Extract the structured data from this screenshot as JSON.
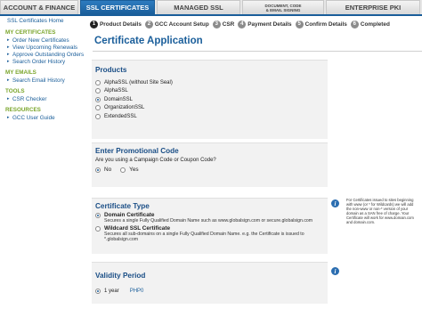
{
  "tabs": [
    {
      "label": "ACCOUNT & FINANCE",
      "active": false
    },
    {
      "label": "SSL CERTIFICATES",
      "active": true
    },
    {
      "label": "MANAGED SSL",
      "active": false
    },
    {
      "label1": "DOCUMENT, CODE",
      "label2": "& EMAIL SIGNING",
      "active": false
    },
    {
      "label": "ENTERPRISE PKI",
      "active": false
    }
  ],
  "sidebar": {
    "home": "SSL Certificates Home",
    "sections": [
      {
        "title": "MY CERTIFICATES",
        "items": [
          "Order New Certificates",
          "View Upcoming Renewals",
          "Approve Outstanding Orders",
          "Search Order History"
        ]
      },
      {
        "title": "MY EMAILS",
        "items": [
          "Search Email History"
        ]
      },
      {
        "title": "TOOLS",
        "items": [
          "CSR Checker"
        ]
      },
      {
        "title": "RESOURCES",
        "items": [
          "GCC User Guide"
        ]
      }
    ]
  },
  "steps": [
    {
      "num": "1",
      "label": "Product Details"
    },
    {
      "num": "2",
      "label": "GCC Account Setup"
    },
    {
      "num": "3",
      "label": "CSR"
    },
    {
      "num": "4",
      "label": "Payment Details"
    },
    {
      "num": "5",
      "label": "Confirm Details"
    },
    {
      "num": "6",
      "label": "Completed"
    }
  ],
  "page_title": "Certificate Application",
  "products": {
    "title": "Products",
    "options": [
      "AlphaSSL (without Site Seal)",
      "AlphaSSL",
      "DomainSSL",
      "OrganizationSSL",
      "ExtendedSSL"
    ],
    "selected": "DomainSSL"
  },
  "promo": {
    "title": "Enter Promotional Code",
    "question": "Are you using a Campaign Code or Coupon Code?",
    "no": "No",
    "yes": "Yes",
    "selected": "No"
  },
  "cert_type": {
    "title": "Certificate Type",
    "domain_name": "Domain Certificate",
    "domain_desc": "Secures a single Fully Qualified Domain Name such as www.globalsign.com or secure.globalsign.com",
    "wildcard_name": "Wildcard SSL Certificate",
    "wildcard_desc1": "Secures all sub-domains on a single Fully Qualified Domain Name. e.g. the Certificate is issued to",
    "wildcard_desc2": "*.globalsign.com",
    "info": "For Certificates issued to sites beginning with www (or * for Wildcards) we will add the non-www or non-* version of your domain as a SAN free of charge. Your Certificate will work for www.domain.com and domain.com."
  },
  "validity": {
    "title": "Validity Period",
    "option": "1 year",
    "price": "PHP0"
  },
  "colors": {
    "accent": "#1a5e9a",
    "green": "#7aa52b",
    "section_bg": "#f2f2f2"
  },
  "icons": [
    "info-icon",
    "radio-icon",
    "arrow-right-icon"
  ]
}
